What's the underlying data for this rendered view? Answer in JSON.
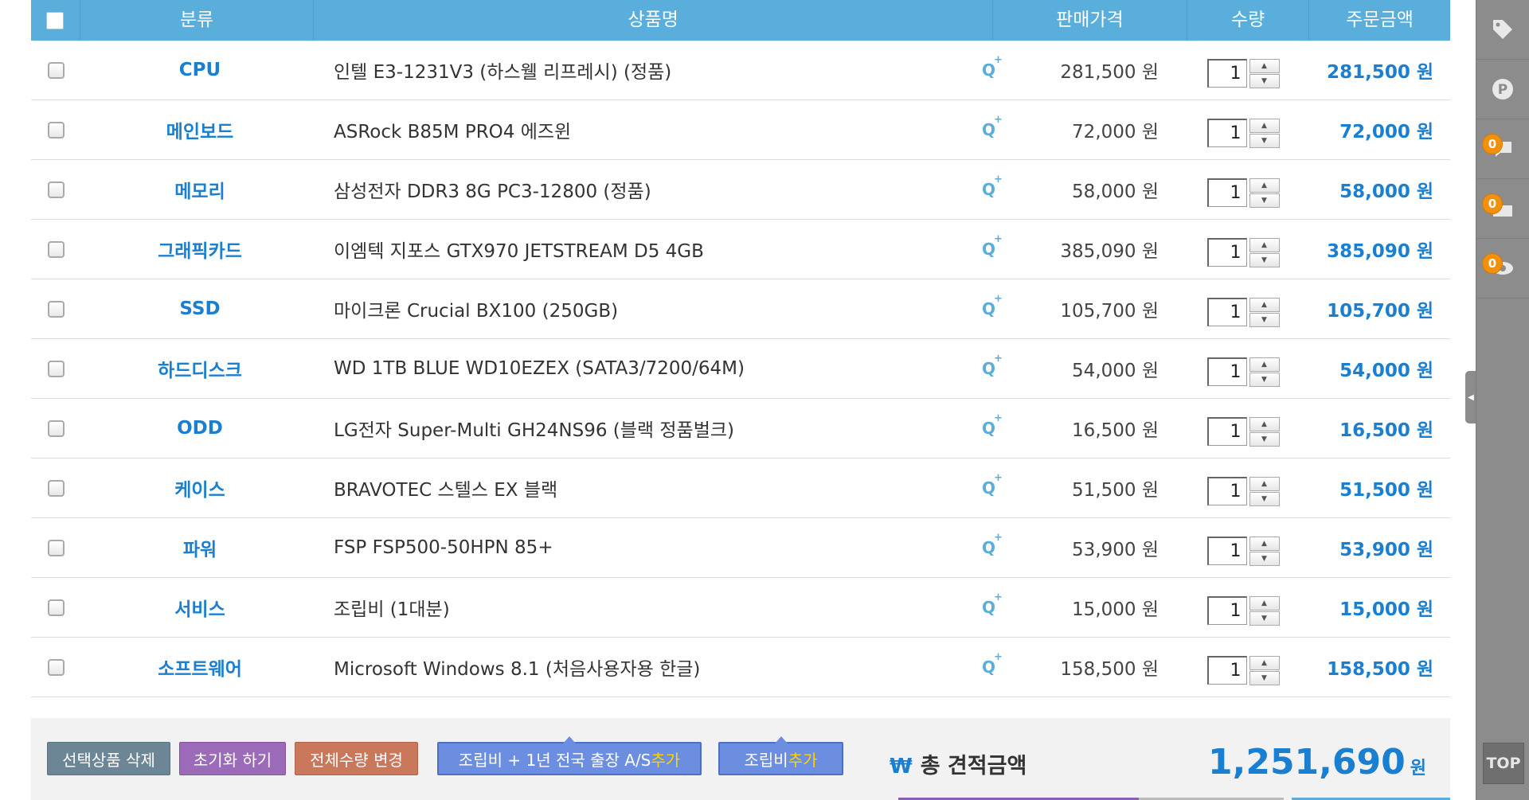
{
  "header": {
    "category": "분류",
    "product": "상품명",
    "price": "판매가격",
    "quantity": "수량",
    "order_amount": "주문금액"
  },
  "rows": [
    {
      "category": "CPU",
      "name": "인텔 E3-1231V3 (하스웰 리프레시) (정품)",
      "price": "281,500 원",
      "qty": "1",
      "total": "281,500 원"
    },
    {
      "category": "메인보드",
      "name": "ASRock B85M PRO4 에즈윈",
      "price": "72,000 원",
      "qty": "1",
      "total": "72,000 원"
    },
    {
      "category": "메모리",
      "name": "삼성전자 DDR3 8G PC3-12800 (정품)",
      "price": "58,000 원",
      "qty": "1",
      "total": "58,000 원"
    },
    {
      "category": "그래픽카드",
      "name": "이엠텍 지포스 GTX970 JETSTREAM D5 4GB",
      "price": "385,090 원",
      "qty": "1",
      "total": "385,090 원"
    },
    {
      "category": "SSD",
      "name": "마이크론 Crucial BX100 (250GB)",
      "price": "105,700 원",
      "qty": "1",
      "total": "105,700 원"
    },
    {
      "category": "하드디스크",
      "name": "WD 1TB BLUE WD10EZEX (SATA3/7200/64M)",
      "price": "54,000 원",
      "qty": "1",
      "total": "54,000 원"
    },
    {
      "category": "ODD",
      "name": "LG전자 Super-Multi GH24NS96 (블랙 정품벌크)",
      "price": "16,500 원",
      "qty": "1",
      "total": "16,500 원"
    },
    {
      "category": "케이스",
      "name": "BRAVOTEC 스텔스 EX 블랙",
      "price": "51,500 원",
      "qty": "1",
      "total": "51,500 원"
    },
    {
      "category": "파워",
      "name": "FSP FSP500-50HPN 85+",
      "price": "53,900 원",
      "qty": "1",
      "total": "53,900 원"
    },
    {
      "category": "서비스",
      "name": "조립비 (1대분)",
      "price": "15,000 원",
      "qty": "1",
      "total": "15,000 원"
    },
    {
      "category": "소프트웨어",
      "name": "Microsoft Windows 8.1 (처음사용자용 한글)",
      "price": "158,500 원",
      "qty": "1",
      "total": "158,500 원"
    }
  ],
  "footer": {
    "delete_selected": "선택상품 삭제",
    "reset": "초기화 하기",
    "change_all_qty": "전체수량 변경",
    "as_button_main": "조립비 + 1년 전국 출장 A/S ",
    "as_button_hl": "추가",
    "assembly_button_main": "조립비 ",
    "assembly_button_hl": "추가",
    "total_label": "총 견적금액",
    "total_value": "1,251,690",
    "total_unit": "원"
  },
  "sidebar": {
    "badges": [
      "0",
      "0",
      "0"
    ],
    "top_label": "TOP"
  },
  "colors": {
    "header_bg": "#5aaedb",
    "accent_blue": "#1a7fd0",
    "badge_orange": "#f0900d",
    "sidebar_gray": "#8c8c8c"
  }
}
